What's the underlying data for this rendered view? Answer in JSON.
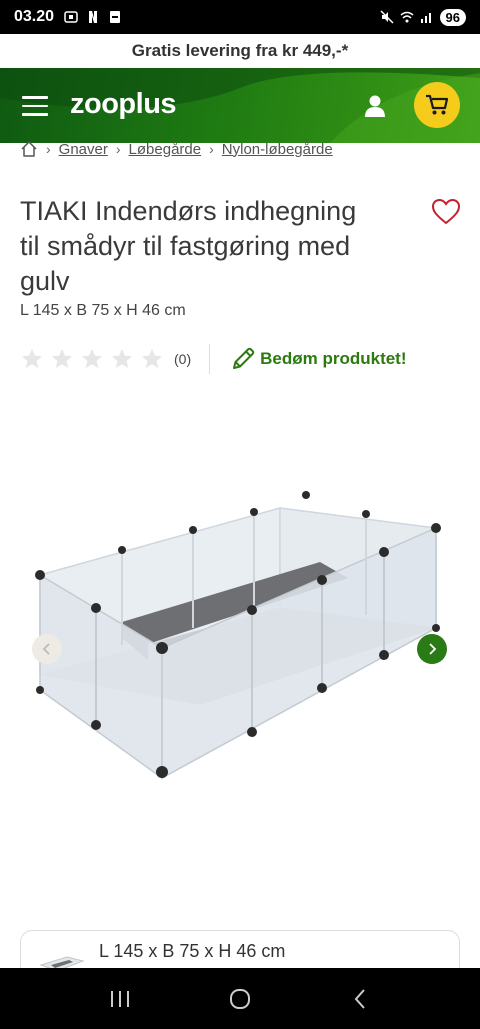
{
  "status": {
    "time": "03.20",
    "battery": "96"
  },
  "promo": {
    "text": "Gratis levering fra kr 449,-*"
  },
  "header": {
    "logo": "zooplus",
    "menu_icon": "hamburger-icon",
    "user_icon": "user-icon",
    "cart_icon": "cart-icon"
  },
  "breadcrumb": {
    "items": [
      "Gnaver",
      "Løbegårde",
      "Nylon-løbegårde"
    ],
    "home_icon": "home-icon"
  },
  "product": {
    "title": "TIAKI Indendørs indhegning til smådyr til fastgøring med gulv",
    "dimensions": "L 145 x B 75 x H 46 cm",
    "rating": 0,
    "review_count": "(0)",
    "rate_label": "Bedøm produktet!"
  },
  "variant": {
    "label": "L 145 x B 75 x H 46 cm"
  },
  "colors": {
    "brand_green": "#2c7a10",
    "cart_yellow": "#f6cc1c",
    "heart": "#c4202f"
  }
}
